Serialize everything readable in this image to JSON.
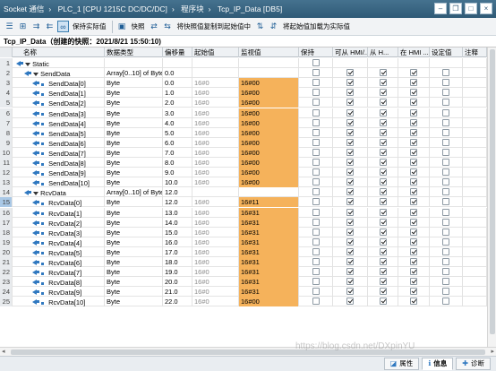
{
  "breadcrumb": [
    "Socket 通信",
    "PLC_1 [CPU 1215C DC/DC/DC]",
    "程序块",
    "Tcp_IP_Data [DB5]"
  ],
  "toolbar": {
    "keep_actual_label": "保持实际值",
    "snapshot_label": "快照",
    "copy_snapshot_label": "将快照值复制到起始值中",
    "load_start_label": "将起始值加载为实际值"
  },
  "block_title": "Tcp_IP_Data（创建的快照：2021/8/21 15:50:10)",
  "columns": {
    "name": "名称",
    "datatype": "数据类型",
    "offset": "偏移量",
    "start": "起始值",
    "monitor": "监视值",
    "retain": "保持",
    "accessible": "可从 HMI/...",
    "writable": "从 H...",
    "visible": "在 HMI ...",
    "setpoint": "设定值",
    "comment": "注释"
  },
  "rows": [
    {
      "idx": "1",
      "name": "Static",
      "type": "",
      "offset": "",
      "start": "",
      "mon": "",
      "level": 0,
      "expand": true,
      "r": false,
      "a": false,
      "w": false,
      "v": false,
      "s": false,
      "cbs": false
    },
    {
      "idx": "2",
      "name": "SendData",
      "type": "Array[0..10] of Byte",
      "offset": "0.0",
      "start": "",
      "mon": "",
      "level": 1,
      "expand": true,
      "r": false,
      "a": true,
      "w": true,
      "v": true,
      "s": false,
      "cbs": true
    },
    {
      "idx": "3",
      "name": "SendData[0]",
      "type": "Byte",
      "offset": "0.0",
      "start": "16#0",
      "mon": "16#00",
      "level": 2,
      "r": false,
      "a": true,
      "w": true,
      "v": true,
      "s": false,
      "cbs": true
    },
    {
      "idx": "4",
      "name": "SendData[1]",
      "type": "Byte",
      "offset": "1.0",
      "start": "16#0",
      "mon": "16#00",
      "level": 2,
      "r": false,
      "a": true,
      "w": true,
      "v": true,
      "s": false,
      "cbs": true
    },
    {
      "idx": "5",
      "name": "SendData[2]",
      "type": "Byte",
      "offset": "2.0",
      "start": "16#0",
      "mon": "16#00",
      "level": 2,
      "r": false,
      "a": true,
      "w": true,
      "v": true,
      "s": false,
      "cbs": true
    },
    {
      "idx": "6",
      "name": "SendData[3]",
      "type": "Byte",
      "offset": "3.0",
      "start": "16#0",
      "mon": "16#00",
      "level": 2,
      "r": false,
      "a": true,
      "w": true,
      "v": true,
      "s": false,
      "cbs": true
    },
    {
      "idx": "7",
      "name": "SendData[4]",
      "type": "Byte",
      "offset": "4.0",
      "start": "16#0",
      "mon": "16#00",
      "level": 2,
      "r": false,
      "a": true,
      "w": true,
      "v": true,
      "s": false,
      "cbs": true
    },
    {
      "idx": "8",
      "name": "SendData[5]",
      "type": "Byte",
      "offset": "5.0",
      "start": "16#0",
      "mon": "16#00",
      "level": 2,
      "r": false,
      "a": true,
      "w": true,
      "v": true,
      "s": false,
      "cbs": true
    },
    {
      "idx": "9",
      "name": "SendData[6]",
      "type": "Byte",
      "offset": "6.0",
      "start": "16#0",
      "mon": "16#00",
      "level": 2,
      "r": false,
      "a": true,
      "w": true,
      "v": true,
      "s": false,
      "cbs": true
    },
    {
      "idx": "10",
      "name": "SendData[7]",
      "type": "Byte",
      "offset": "7.0",
      "start": "16#0",
      "mon": "16#00",
      "level": 2,
      "r": false,
      "a": true,
      "w": true,
      "v": true,
      "s": false,
      "cbs": true
    },
    {
      "idx": "11",
      "name": "SendData[8]",
      "type": "Byte",
      "offset": "8.0",
      "start": "16#0",
      "mon": "16#00",
      "level": 2,
      "r": false,
      "a": true,
      "w": true,
      "v": true,
      "s": false,
      "cbs": true
    },
    {
      "idx": "12",
      "name": "SendData[9]",
      "type": "Byte",
      "offset": "9.0",
      "start": "16#0",
      "mon": "16#00",
      "level": 2,
      "r": false,
      "a": true,
      "w": true,
      "v": true,
      "s": false,
      "cbs": true
    },
    {
      "idx": "13",
      "name": "SendData[10]",
      "type": "Byte",
      "offset": "10.0",
      "start": "16#0",
      "mon": "16#00",
      "level": 2,
      "r": false,
      "a": true,
      "w": true,
      "v": true,
      "s": false,
      "cbs": true
    },
    {
      "idx": "14",
      "name": "RcvData",
      "type": "Array[0..10] of Byte",
      "offset": "12.0",
      "start": "",
      "mon": "",
      "level": 1,
      "expand": true,
      "r": false,
      "a": true,
      "w": true,
      "v": true,
      "s": false,
      "cbs": true
    },
    {
      "idx": "15",
      "name": "RcvData[0]",
      "type": "Byte",
      "offset": "12.0",
      "start": "16#0",
      "mon": "16#11",
      "level": 2,
      "sel": true,
      "r": false,
      "a": true,
      "w": true,
      "v": true,
      "s": false,
      "cbs": true
    },
    {
      "idx": "16",
      "name": "RcvData[1]",
      "type": "Byte",
      "offset": "13.0",
      "start": "16#0",
      "mon": "16#31",
      "level": 2,
      "r": false,
      "a": true,
      "w": true,
      "v": true,
      "s": false,
      "cbs": true
    },
    {
      "idx": "17",
      "name": "RcvData[2]",
      "type": "Byte",
      "offset": "14.0",
      "start": "16#0",
      "mon": "16#31",
      "level": 2,
      "r": false,
      "a": true,
      "w": true,
      "v": true,
      "s": false,
      "cbs": true
    },
    {
      "idx": "18",
      "name": "RcvData[3]",
      "type": "Byte",
      "offset": "15.0",
      "start": "16#0",
      "mon": "16#31",
      "level": 2,
      "r": false,
      "a": true,
      "w": true,
      "v": true,
      "s": false,
      "cbs": true
    },
    {
      "idx": "19",
      "name": "RcvData[4]",
      "type": "Byte",
      "offset": "16.0",
      "start": "16#0",
      "mon": "16#31",
      "level": 2,
      "r": false,
      "a": true,
      "w": true,
      "v": true,
      "s": false,
      "cbs": true
    },
    {
      "idx": "20",
      "name": "RcvData[5]",
      "type": "Byte",
      "offset": "17.0",
      "start": "16#0",
      "mon": "16#31",
      "level": 2,
      "r": false,
      "a": true,
      "w": true,
      "v": true,
      "s": false,
      "cbs": true
    },
    {
      "idx": "21",
      "name": "RcvData[6]",
      "type": "Byte",
      "offset": "18.0",
      "start": "16#0",
      "mon": "16#31",
      "level": 2,
      "r": false,
      "a": true,
      "w": true,
      "v": true,
      "s": false,
      "cbs": true
    },
    {
      "idx": "22",
      "name": "RcvData[7]",
      "type": "Byte",
      "offset": "19.0",
      "start": "16#0",
      "mon": "16#31",
      "level": 2,
      "r": false,
      "a": true,
      "w": true,
      "v": true,
      "s": false,
      "cbs": true
    },
    {
      "idx": "23",
      "name": "RcvData[8]",
      "type": "Byte",
      "offset": "20.0",
      "start": "16#0",
      "mon": "16#31",
      "level": 2,
      "r": false,
      "a": true,
      "w": true,
      "v": true,
      "s": false,
      "cbs": true
    },
    {
      "idx": "24",
      "name": "RcvData[9]",
      "type": "Byte",
      "offset": "21.0",
      "start": "16#0",
      "mon": "16#31",
      "level": 2,
      "r": false,
      "a": true,
      "w": true,
      "v": true,
      "s": false,
      "cbs": true
    },
    {
      "idx": "25",
      "name": "RcvData[10]",
      "type": "Byte",
      "offset": "22.0",
      "start": "16#0",
      "mon": "16#00",
      "level": 2,
      "r": false,
      "a": true,
      "w": true,
      "v": true,
      "s": false,
      "cbs": true
    }
  ],
  "status_tabs": {
    "properties": "属性",
    "info": "信息",
    "diagnostics": "诊断"
  },
  "watermark": "https://blog.csdn.net/DXpinYU",
  "colors": {
    "monitor_bg": "#f5b25b",
    "header_bar": "#3b6785",
    "accent": "#2f78c0"
  }
}
